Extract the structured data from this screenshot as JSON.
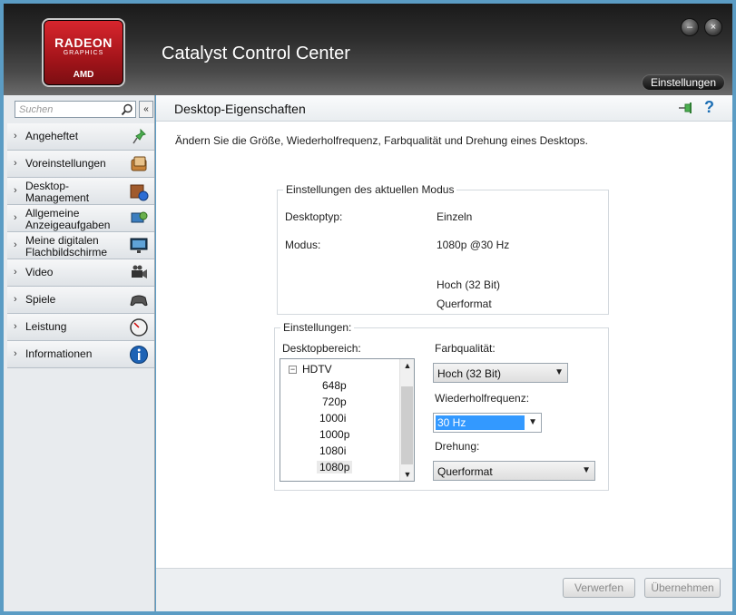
{
  "header": {
    "logo": {
      "line1": "RADEON",
      "line2": "GRAPHICS",
      "line3": "AMD"
    },
    "title": "Catalyst Control Center",
    "settings_label": "Einstellungen",
    "minimize_glyph": "–",
    "close_glyph": "×"
  },
  "sidebar": {
    "search_placeholder": "Suchen",
    "collapse_glyph": "«",
    "items": [
      {
        "label": "Angeheftet",
        "icon": "pin-icon"
      },
      {
        "label": "Voreinstellungen",
        "icon": "presets-icon"
      },
      {
        "label": "Desktop-\nManagement",
        "icon": "desktop-management-icon"
      },
      {
        "label": "Allgemeine\nAnzeigeaufgaben",
        "icon": "display-tasks-icon"
      },
      {
        "label": "Meine digitalen\nFlachbildschirme",
        "icon": "flat-panel-icon"
      },
      {
        "label": "Video",
        "icon": "video-camera-icon"
      },
      {
        "label": "Spiele",
        "icon": "gamepad-icon"
      },
      {
        "label": "Leistung",
        "icon": "gauge-icon"
      },
      {
        "label": "Informationen",
        "icon": "info-icon"
      }
    ]
  },
  "main": {
    "title": "Desktop-Eigenschaften",
    "description": "Ändern Sie die Größe, Wiederholfrequenz, Farbqualität und Drehung eines Desktops.",
    "current_mode": {
      "title": "Einstellungen des aktuellen Modus",
      "desktop_type_label": "Desktoptyp:",
      "desktop_type_value": "Einzeln",
      "mode_label": "Modus:",
      "mode_value": "1080p @30 Hz",
      "color_value": "Hoch (32 Bit)",
      "orientation_value": "Querformat"
    },
    "settings": {
      "title": "Einstellungen:",
      "desktop_area_label": "Desktopbereich:",
      "tree_root": "HDTV",
      "tree_toggle": "−",
      "resolutions": [
        "648p",
        "720p",
        "1000i",
        "1000p",
        "1080i",
        "1080p"
      ],
      "selected_resolution": "1080p",
      "color_quality_label": "Farbqualität:",
      "color_quality_value": "Hoch (32 Bit)",
      "refresh_label": "Wiederholfrequenz:",
      "refresh_value": "30 Hz",
      "rotation_label": "Drehung:",
      "rotation_value": "Querformat"
    }
  },
  "footer": {
    "discard_label": "Verwerfen",
    "apply_label": "Übernehmen"
  }
}
